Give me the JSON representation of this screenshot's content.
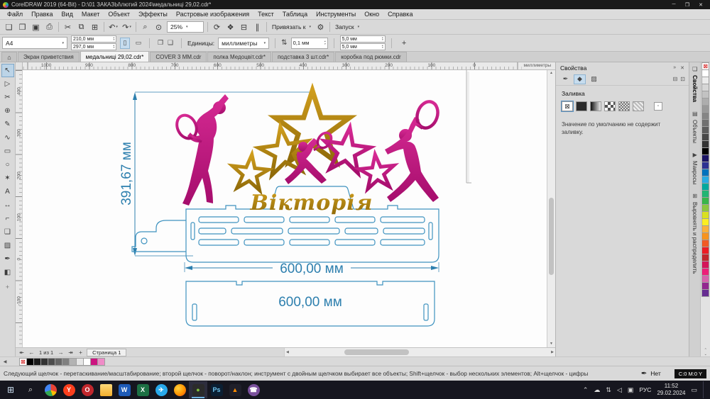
{
  "titlebar": {
    "title": "CorelDRAW 2019 (64-Bit) - D:\\01 ЗАКАЗЫ\\лютий 2024\\медальниці 29,02.cdr*",
    "controls": [
      {
        "name": "minimize-button",
        "glyph": "─"
      },
      {
        "name": "maximize-button",
        "glyph": "❐"
      },
      {
        "name": "close-button",
        "glyph": "✕"
      }
    ]
  },
  "menubar": {
    "items": [
      "Файл",
      "Правка",
      "Вид",
      "Макет",
      "Объект",
      "Эффекты",
      "Растровые изображения",
      "Текст",
      "Таблица",
      "Инструменты",
      "Окно",
      "Справка"
    ]
  },
  "toolbar": {
    "file_buttons": [
      {
        "name": "new-document-button",
        "glyph": "❏"
      },
      {
        "name": "open-button",
        "glyph": "❒"
      },
      {
        "name": "save-button",
        "glyph": "▣"
      },
      {
        "name": "print-button",
        "glyph": "⎙"
      }
    ],
    "edit_buttons": [
      {
        "name": "cut-button",
        "glyph": "✂"
      },
      {
        "name": "copy-button",
        "glyph": "⧉"
      },
      {
        "name": "paste-button",
        "glyph": "⊞"
      }
    ],
    "history_buttons": [
      {
        "name": "undo-button",
        "glyph": "↶",
        "cls": "drop"
      },
      {
        "name": "redo-button",
        "glyph": "↷",
        "cls": "drop"
      }
    ],
    "view_buttons": [
      {
        "name": "search-button",
        "glyph": "⌕"
      },
      {
        "name": "zoom-tool-button",
        "glyph": "⊙"
      }
    ],
    "zoom_value": "25%",
    "display_buttons": [
      {
        "name": "refresh-view-button",
        "glyph": "⟳"
      },
      {
        "name": "fullscreen-preview-button",
        "glyph": "❖"
      },
      {
        "name": "show-grid-button",
        "glyph": "⊟"
      },
      {
        "name": "show-guidelines-button",
        "glyph": "∥"
      }
    ],
    "snap_label": "Привязать к",
    "options_icon": "⚙",
    "launch_label": "Запуск"
  },
  "property_bar": {
    "page_preset": "A4",
    "page_width": "210,0 мм",
    "page_height": "297,0 мм",
    "orientation_icons": {
      "portrait": "▯",
      "landscape": "▭"
    },
    "page_icons": [
      {
        "name": "current-page-button",
        "glyph": "❐"
      },
      {
        "name": "all-pages-button",
        "glyph": "❑"
      }
    ],
    "units_label": "Единицы:",
    "units_value": "миллиметры",
    "nudge_icon": "⇅",
    "nudge_value": "0,1 мм",
    "duplicate_x": "5,0 мм",
    "duplicate_y": "5,0 мм",
    "add_label": "+"
  },
  "doc_tabs": {
    "home_icon": "⌂",
    "tabs": [
      {
        "name": "tab-welcome-screen",
        "label": "Экран приветствия"
      },
      {
        "name": "tab-medalnytsi",
        "label": "медальниці 29,02.cdr*",
        "active": true
      },
      {
        "name": "tab-cover",
        "label": "COVER 3 MM.cdr"
      },
      {
        "name": "tab-polka",
        "label": "полка Медоцвіт.cdr*"
      },
      {
        "name": "tab-podstavka",
        "label": "подставка 3 шт.cdr*"
      },
      {
        "name": "tab-korobka",
        "label": "коробка под рюмки.cdr"
      }
    ]
  },
  "toolbox": {
    "tools": [
      {
        "name": "pick-tool",
        "glyph": "↖",
        "selected": true
      },
      {
        "name": "shape-tool",
        "glyph": "▷"
      },
      {
        "name": "crop-tool",
        "glyph": "✂"
      },
      {
        "name": "zoom-tool",
        "glyph": "⊕"
      },
      {
        "name": "freehand-tool",
        "glyph": "✎"
      },
      {
        "name": "artistic-media-tool",
        "glyph": "∿"
      },
      {
        "name": "rectangle-tool",
        "glyph": "▭"
      },
      {
        "name": "ellipse-tool",
        "glyph": "○"
      },
      {
        "name": "polygon-tool",
        "glyph": "✶"
      },
      {
        "name": "text-tool",
        "glyph": "A"
      },
      {
        "name": "dimension-tool",
        "glyph": "↔"
      },
      {
        "name": "connector-tool",
        "glyph": "⌐"
      },
      {
        "name": "drop-shadow-tool",
        "glyph": "❑"
      },
      {
        "name": "transparency-tool",
        "glyph": "▨"
      },
      {
        "name": "eyedropper-tool",
        "glyph": "✒"
      },
      {
        "name": "interactive-fill-tool",
        "glyph": "◧"
      }
    ],
    "add_icon": "+"
  },
  "rulers": {
    "h_labels": [
      "1000",
      "900",
      "800",
      "700",
      "600",
      "500",
      "400",
      "300",
      "200",
      "100",
      "0"
    ],
    "v_labels": [
      "400",
      "300",
      "200",
      "100",
      "0",
      "-100"
    ],
    "unit_label": "миллиметры"
  },
  "canvas": {
    "title_text": "Вікторія",
    "dim_height": "391,67 мм",
    "dim_width_top": "600,00 мм",
    "dim_width_bottom": "600,00 мм",
    "colors": {
      "gold": "#b28415",
      "magenta": "#c2187e",
      "outline_blue": "#3f93c0",
      "dim_blue": "#2d7fae"
    }
  },
  "right_panel": {
    "title": "Свойства",
    "header_icons": [
      {
        "name": "pin-panel-icon",
        "glyph": "»"
      },
      {
        "name": "close-panel-icon",
        "glyph": "✕"
      }
    ],
    "section_tabs": [
      {
        "name": "outline-section-tab",
        "glyph": "✒"
      },
      {
        "name": "fill-section-tab",
        "glyph": "◆",
        "active": true
      },
      {
        "name": "transparency-section-tab",
        "glyph": "▨"
      }
    ],
    "corner_icons": [
      {
        "name": "dock-panel-icon",
        "glyph": "⊟"
      },
      {
        "name": "float-panel-icon",
        "glyph": "⊡"
      }
    ],
    "section_title": "Заливка",
    "fill_types": [
      {
        "name": "no-fill-button",
        "glyph": "⊠",
        "active": true
      },
      {
        "name": "uniform-fill-button",
        "cls": "solid"
      },
      {
        "name": "fountain-fill-button",
        "cls": "grad"
      },
      {
        "name": "pattern-fill-button",
        "cls": "checker"
      },
      {
        "name": "bitmap-pattern-fill-button",
        "cls": "bitmap"
      },
      {
        "name": "texture-fill-button",
        "cls": "texture"
      },
      {
        "name": "winding-fill-button",
        "glyph": "▫",
        "cls": "mini"
      }
    ],
    "message": "Значение по умолчанию не содержит заливку."
  },
  "docker": {
    "tabs": [
      {
        "name": "docker-tab-properties",
        "glyph": "❏",
        "label": "Свойства",
        "active": true
      },
      {
        "name": "docker-tab-objects",
        "glyph": "▤",
        "label": "Объекты"
      },
      {
        "name": "docker-tab-macros",
        "glyph": "▶",
        "label": "Макросы"
      },
      {
        "name": "docker-tab-align",
        "glyph": "⊞",
        "label": "Выровнять и распределить"
      }
    ]
  },
  "palette_right": {
    "none_glyph": "⊠",
    "colors": [
      "#ffffff",
      "#ebebeb",
      "#d6d6d6",
      "#c2c2c2",
      "#adadad",
      "#999999",
      "#858585",
      "#707070",
      "#5c5c5c",
      "#474747",
      "#333333",
      "#000000",
      "#1b1464",
      "#2e3192",
      "#0071bc",
      "#29abe2",
      "#00a99d",
      "#22b573",
      "#39b54a",
      "#8cc63f",
      "#d9e021",
      "#fcee21",
      "#fbb03b",
      "#f7931e",
      "#f15a24",
      "#ed1c24",
      "#c1272d",
      "#d4145a",
      "#ed1e79",
      "#d663ad",
      "#93278f",
      "#662d91"
    ],
    "scroll_up_icon": "⌃",
    "scroll_down_icon": "⌄"
  },
  "palette_bottom": {
    "scroll_icon": "◀",
    "none_glyph": "⊠",
    "colors": [
      "#000000",
      "#1a1a1a",
      "#333333",
      "#4d4d4d",
      "#666666",
      "#808080",
      "#b3b3b3",
      "#e6e6e6",
      "#ffffff",
      "#cc1480",
      "#ef8bc7"
    ]
  },
  "page_nav": {
    "first_icon": "↞",
    "prev_icon": "←",
    "counter": "1 из 1",
    "next_icon": "→",
    "last_icon": "↠",
    "add_icon": "+",
    "page_tab": "Страница 1"
  },
  "scrollbars": {
    "up_icon": "▲",
    "down_icon": "▼",
    "left_icon": "◀",
    "right_icon": "▶"
  },
  "status_bar": {
    "hint": "Следующий щелчок - перетаскивание/масштабирование; второй щелчок - поворот/наклон; инструмент с двойным щелчком выбирает все объекты; Shift+щелчок - выбор нескольких элементов; Alt+щелчок - цифры",
    "outline_icon": "✒",
    "outline_value": "Нет",
    "fill_value": "C:0 M:0 Y"
  },
  "taskbar": {
    "start_icon": "⊞",
    "search_icon": "⌕",
    "apps": [
      {
        "name": "chrome-icon",
        "glyph": "",
        "bg": "conic-gradient(#ea4335 0 30%, #fbbc05 30% 45%, #34a853 45% 70%, #4285f4 70%)",
        "cls": "round"
      },
      {
        "name": "yandex-browser-icon",
        "glyph": "Y",
        "fg": "#ffffff",
        "bg": "#fc3f1d",
        "cls": "round"
      },
      {
        "name": "opera-icon",
        "glyph": "O",
        "fg": "#ffffff",
        "bg": "#c1272d",
        "cls": "round"
      },
      {
        "name": "explorer-folder-icon",
        "glyph": "",
        "bg": "linear-gradient(#ffd97a,#f2ae2e)",
        "cls": "folder"
      },
      {
        "name": "word-icon",
        "glyph": "W",
        "fg": "#ffffff",
        "bg": "#1e5bb8"
      },
      {
        "name": "excel-icon",
        "glyph": "X",
        "fg": "#ffffff",
        "bg": "#1d7044"
      },
      {
        "name": "telegram-icon",
        "glyph": "✈",
        "fg": "#ffffff",
        "bg": "#29a9eb",
        "cls": "round"
      },
      {
        "name": "firefox-icon",
        "glyph": "",
        "bg": "radial-gradient(circle at 35% 35%, #ffd23e, #ff9400 55%, #e1431f)",
        "cls": "round"
      },
      {
        "name": "coreldraw-icon",
        "glyph": "●",
        "fg": "#7ec13d",
        "bg": "#2b2b2b",
        "active": true
      },
      {
        "name": "photoshop-icon",
        "glyph": "Ps",
        "fg": "#6fc5f0",
        "bg": "#0b1f33"
      },
      {
        "name": "vlc-icon",
        "glyph": "▲",
        "fg": "#ff8c00",
        "bg": "#1f1f2a"
      },
      {
        "name": "viber-icon",
        "glyph": "☎",
        "fg": "#ffffff",
        "bg": "#7b519d",
        "cls": "round"
      }
    ],
    "tray": [
      {
        "name": "hidden-icons-chevron",
        "glyph": "⌃"
      },
      {
        "name": "onedrive-icon",
        "glyph": "☁"
      },
      {
        "name": "network-icon",
        "glyph": "⇅"
      },
      {
        "name": "volume-icon",
        "glyph": "◁"
      },
      {
        "name": "shield-icon",
        "glyph": "▣"
      }
    ],
    "lang": "РУС",
    "time": "11:52",
    "date": "29.02.2024",
    "notification_icon": "▭"
  }
}
